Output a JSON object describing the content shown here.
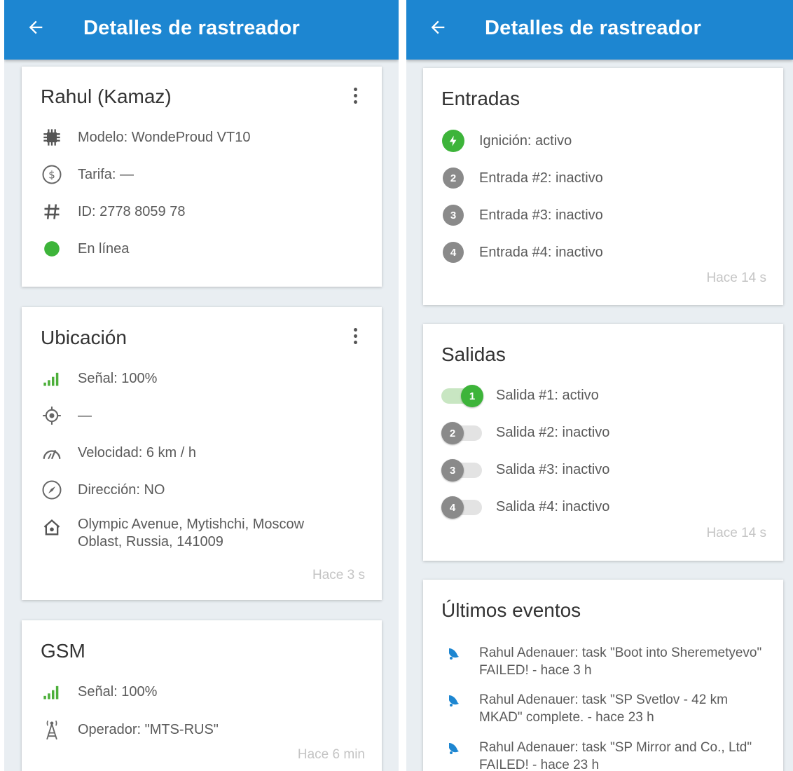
{
  "app": {
    "title": "Detalles de rastreador"
  },
  "tracker_card": {
    "name": "Rahul (Kamaz)",
    "model": "Modelo: WondeProud VT10",
    "tariff": "Tarifa: —",
    "id": "ID: 2778 8059 78",
    "status": "En línea",
    "status_color": "#3db43a"
  },
  "location_card": {
    "title": "Ubicación",
    "signal": "Señal: 100%",
    "satellites": "—",
    "speed": "Velocidad: 6 km / h",
    "direction": "Dirección: NO",
    "address": "Olympic Avenue, Mytishchi, Moscow Oblast, Russia, 141009",
    "updated": "Hace 3 s"
  },
  "gsm_card": {
    "title": "GSM",
    "signal": "Señal: 100%",
    "operator": "Operador: \"MTS-RUS\"",
    "updated": "Hace 6 min"
  },
  "inputs_card": {
    "title": "Entradas",
    "items": [
      {
        "badge": "",
        "label": "Ignición: activo",
        "active": true
      },
      {
        "badge": "2",
        "label": "Entrada #2: inactivo",
        "active": false
      },
      {
        "badge": "3",
        "label": "Entrada #3: inactivo",
        "active": false
      },
      {
        "badge": "4",
        "label": "Entrada #4: inactivo",
        "active": false
      }
    ],
    "updated": "Hace 14 s"
  },
  "outputs_card": {
    "title": "Salidas",
    "items": [
      {
        "badge": "1",
        "label": "Salida #1: activo",
        "active": true
      },
      {
        "badge": "2",
        "label": "Salida #2: inactivo",
        "active": false
      },
      {
        "badge": "3",
        "label": "Salida #3: inactivo",
        "active": false
      },
      {
        "badge": "4",
        "label": "Salida #4: inactivo",
        "active": false
      }
    ],
    "updated": "Hace 14 s"
  },
  "events_card": {
    "title": "Últimos eventos",
    "items": [
      {
        "text": "Rahul Adenauer:  task \"Boot into Sheremetyevo\" FAILED! - hace 3 h"
      },
      {
        "text": "Rahul Adenauer:  task \"SP Svetlov - 42 km MKAD\" complete. - hace 23 h"
      },
      {
        "text": "Rahul Adenauer:  task \"SP Mirror and Co., Ltd\" FAILED! - hace 23 h"
      }
    ]
  },
  "colors": {
    "appbar": "#1d86d1",
    "background": "#e9eef2",
    "active_green": "#3db43a",
    "inactive_gray": "#8a8a8a",
    "event_icon_blue": "#1d86d1"
  },
  "icons": {
    "back": "arrow-left-icon",
    "menu": "more-vert-icon",
    "model": "chip-icon",
    "tariff": "dollar-circle-icon",
    "id": "hash-icon",
    "status": "status-dot-icon",
    "signal": "signal-bars-icon",
    "satellites": "gps-target-icon",
    "speed": "speedometer-icon",
    "direction": "compass-icon",
    "address": "home-icon",
    "operator": "antenna-tower-icon",
    "ignition": "bolt-icon",
    "event": "bell-icon"
  }
}
